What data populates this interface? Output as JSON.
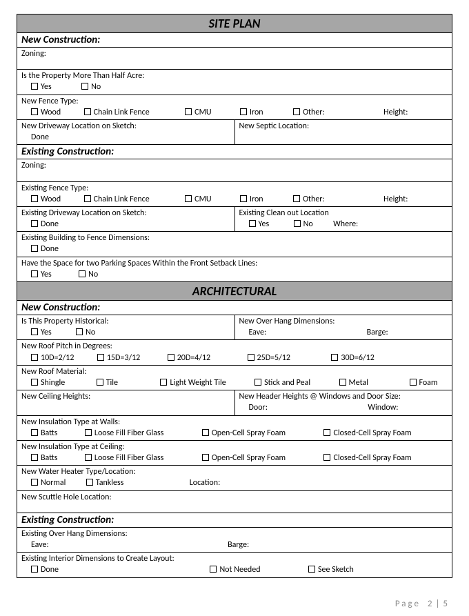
{
  "sections": {
    "site_plan": {
      "title": "SITE PLAN",
      "new_construction": {
        "heading": "New Construction:",
        "zoning_label": "Zoning:",
        "half_acre_label": "Is the Property More Than Half Acre:",
        "yes": "Yes",
        "no": "No",
        "fence_type_label": "New Fence Type:",
        "fence": {
          "wood": "Wood",
          "chain": "Chain Link Fence",
          "cmu": "CMU",
          "iron": "Iron",
          "other": "Other:",
          "height": "Height:"
        },
        "driveway_label": "New Driveway Location on Sketch:",
        "done": "Done",
        "septic_label": "New Septic Location:"
      },
      "existing_construction": {
        "heading": "Existing Construction:",
        "zoning_label": "Zoning:",
        "fence_type_label": "Existing Fence Type:",
        "fence": {
          "wood": "Wood",
          "chain": "Chain Link Fence",
          "cmu": "CMU",
          "iron": "Iron",
          "other": "Other:",
          "height": "Height:"
        },
        "driveway_label": "Existing Driveway Location on Sketch:",
        "cleanout_label": "Existing Clean out Location",
        "yes": "Yes",
        "no": "No",
        "where": "Where:",
        "done": "Done",
        "building_fence_label": "Existing Building to Fence Dimensions:",
        "parking_label": "Have the Space for two Parking Spaces Within the Front Setback Lines:"
      }
    },
    "architectural": {
      "title": "ARCHITECTURAL",
      "new_construction": {
        "heading": "New Construction:",
        "historical_label": "Is This Property Historical:",
        "yes": "Yes",
        "no": "No",
        "overhang_label": "New Over Hang Dimensions:",
        "eave": "Eave:",
        "barge": "Barge:",
        "roof_pitch_label": "New Roof Pitch in Degrees:",
        "pitch": {
          "p1": "10D=2/12",
          "p2": "15D=3/12",
          "p3": "20D=4/12",
          "p4": "25D=5/12",
          "p5": "30D=6/12"
        },
        "roof_material_label": "New Roof Material:",
        "roof": {
          "shingle": "Shingle",
          "tile": "Tile",
          "lwt": "Light Weight Tile",
          "stick": "Stick and Peal",
          "metal": "Metal",
          "foam": "Foam"
        },
        "ceiling_heights_label": "New Ceiling Heights:",
        "header_heights_label": "New Header Heights @ Windows and Door Size:",
        "door": "Door:",
        "window": "Window:",
        "insulation_walls_label": "New Insulation Type at Walls:",
        "insulation_ceiling_label": "New Insulation Type at Ceiling:",
        "insul": {
          "batts": "Batts",
          "loose": "Loose Fill Fiber Glass",
          "open": "Open-Cell Spray Foam",
          "closed": "Closed-Cell Spray Foam"
        },
        "water_heater_label": "New Water Heater Type/Location:",
        "heater": {
          "normal": "Normal",
          "tankless": "Tankless",
          "location": "Location:"
        },
        "scuttle_label": "New Scuttle Hole Location:"
      },
      "existing_construction": {
        "heading": "Existing Construction:",
        "overhang_label": "Existing Over Hang Dimensions:",
        "eave": "Eave:",
        "barge": "Barge:",
        "interior_label": "Existing Interior Dimensions to Create Layout:",
        "done": "Done",
        "not_needed": "Not Needed",
        "see_sketch": "See Sketch"
      }
    }
  },
  "footer": {
    "page_word": "Page",
    "current": "2",
    "sep": "|",
    "total": "5"
  }
}
